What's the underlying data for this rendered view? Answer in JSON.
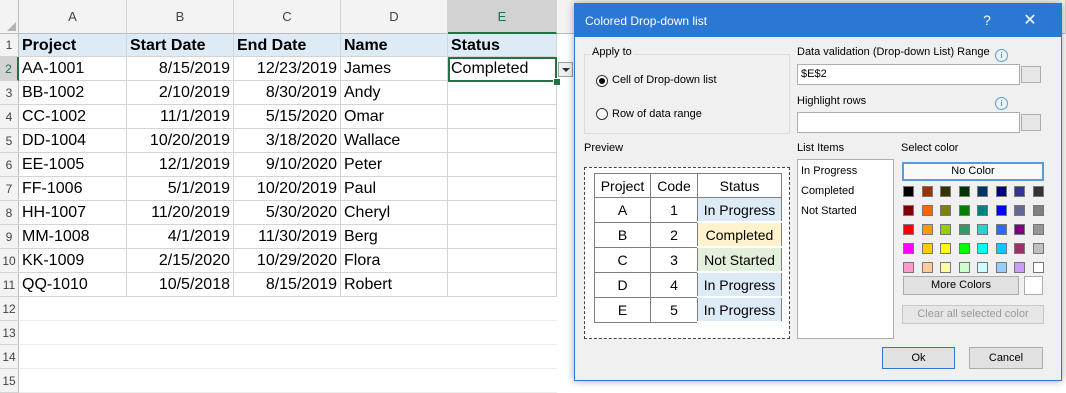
{
  "sheet": {
    "columns": [
      "A",
      "B",
      "C",
      "D",
      "E"
    ],
    "rows": [
      "1",
      "2",
      "3",
      "4",
      "5",
      "6",
      "7",
      "8",
      "9",
      "10",
      "11",
      "12",
      "13",
      "14",
      "15"
    ],
    "headers": [
      "Project",
      "Start Date",
      "End Date",
      "Name",
      "Status"
    ],
    "data": [
      [
        "AA-1001",
        "8/15/2019",
        "12/23/2019",
        "James",
        "Completed"
      ],
      [
        "BB-1002",
        "2/10/2019",
        "8/30/2019",
        "Andy",
        ""
      ],
      [
        "CC-1002",
        "11/1/2019",
        "5/15/2020",
        "Omar",
        ""
      ],
      [
        "DD-1004",
        "10/20/2019",
        "3/18/2020",
        "Wallace",
        ""
      ],
      [
        "EE-1005",
        "12/1/2019",
        "9/10/2020",
        "Peter",
        ""
      ],
      [
        "FF-1006",
        "5/1/2019",
        "10/20/2019",
        "Paul",
        ""
      ],
      [
        "HH-1007",
        "11/20/2019",
        "5/30/2020",
        "Cheryl",
        ""
      ],
      [
        "MM-1008",
        "4/1/2019",
        "11/30/2019",
        "Berg",
        ""
      ],
      [
        "KK-1009",
        "2/15/2020",
        "10/29/2020",
        "Flora",
        ""
      ],
      [
        "QQ-1010",
        "10/5/2018",
        "8/15/2019",
        "Robert",
        ""
      ]
    ],
    "header_fill": "#ddebf7",
    "selection_color": "#217346"
  },
  "dialog": {
    "title": "Colored Drop-down list",
    "help_glyph": "?",
    "close_glyph": "✕",
    "apply_to": {
      "label": "Apply to",
      "option1": "Cell of Drop-down list",
      "option2": "Row of data range",
      "selected": "Cell of Drop-down list"
    },
    "range_label": "Data validation (Drop-down List) Range",
    "range_value": "$E$2",
    "highlight_label": "Highlight rows",
    "highlight_value": "",
    "info_glyph": "i",
    "preview": {
      "label": "Preview",
      "headers": [
        "Project",
        "Code",
        "Status"
      ],
      "rows": [
        [
          "A",
          "1",
          "In Progress"
        ],
        [
          "B",
          "2",
          "Completed"
        ],
        [
          "C",
          "3",
          "Not Started"
        ],
        [
          "D",
          "4",
          "In Progress"
        ],
        [
          "E",
          "5",
          "In Progress"
        ]
      ],
      "status_colors": [
        "#ddebf7",
        "#fff2cc",
        "#e2efda",
        "#ddebf7",
        "#ddebf7"
      ]
    },
    "list_items_label": "List Items",
    "list_items": [
      "In Progress",
      "Completed",
      "Not Started"
    ],
    "select_color_label": "Select color",
    "no_color_label": "No Color",
    "palette": [
      [
        "#000000",
        "#993300",
        "#333300",
        "#003300",
        "#003366",
        "#000080",
        "#333399",
        "#333333"
      ],
      [
        "#800000",
        "#ff6600",
        "#808000",
        "#008000",
        "#008080",
        "#0000ff",
        "#666699",
        "#808080"
      ],
      [
        "#ff0000",
        "#ff9900",
        "#99cc00",
        "#339966",
        "#33cccc",
        "#3366ff",
        "#800080",
        "#969696"
      ],
      [
        "#ff00ff",
        "#ffcc00",
        "#ffff00",
        "#00ff00",
        "#00ffff",
        "#00ccff",
        "#993366",
        "#c0c0c0"
      ],
      [
        "#ff99cc",
        "#ffcc99",
        "#ffff99",
        "#ccffcc",
        "#ccffff",
        "#99ccff",
        "#cc99ff",
        "#ffffff"
      ]
    ],
    "more_colors_label": "More Colors",
    "clear_label": "Clear all selected color",
    "ok_label": "Ok",
    "cancel_label": "Cancel",
    "accent_color": "#2b78d4"
  }
}
